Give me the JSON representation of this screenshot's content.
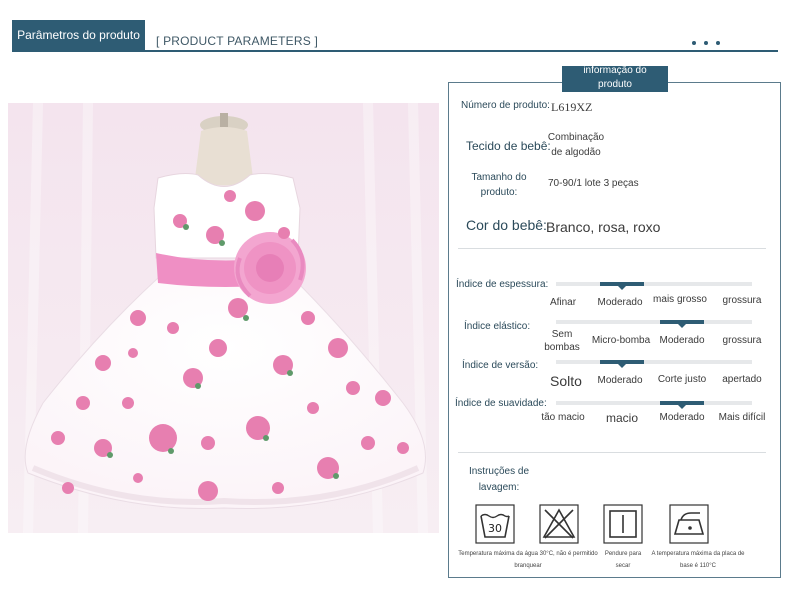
{
  "header": {
    "title": "Parâmetros do produto",
    "subtitle": "[ PRODUCT PARAMETERS ]"
  },
  "panel": {
    "badge": "informação do produto",
    "product_number": {
      "label": "Número de produto:",
      "value": "L619XZ"
    },
    "fabric": {
      "label": "Tecido de bebê:",
      "value": "Combinação de algodão"
    },
    "size": {
      "label": "Tamanho do produto:",
      "value": "70-90/1 lote 3 peças"
    },
    "color": {
      "label": "Cor do bebê:",
      "value": "Branco, rosa, roxo"
    },
    "indices": [
      {
        "label": "Índice de espessura:",
        "options": [
          "Afinar",
          "Moderado",
          "mais grosso",
          "grossura"
        ],
        "selected_index": 1
      },
      {
        "label": "Índice elástico:",
        "options": [
          "Sem bombas",
          "Micro-bomba",
          "Moderado",
          "grossura"
        ],
        "selected_index": 2
      },
      {
        "label": "Índice de versão:",
        "options": [
          "Solto",
          "Moderado",
          "Corte justo",
          "apertado"
        ],
        "selected_index": 1
      },
      {
        "label": "Índice de suavidade:",
        "options": [
          "tão macio",
          "macio",
          "Moderado",
          "Mais difícil"
        ],
        "selected_index": 2
      }
    ],
    "washing": {
      "title": "Instruções de lavagem:",
      "icons": [
        {
          "icon": "wash-30-icon",
          "number": "30",
          "caption": "Temperatura máxima da água 30°C, não é permitido branquear"
        },
        {
          "icon": "no-bleach-icon",
          "caption": ""
        },
        {
          "icon": "hang-dry-icon",
          "caption": "Pendure para secar"
        },
        {
          "icon": "iron-low-icon",
          "caption": "A temperatura máxima da placa de base é 110°C"
        }
      ]
    }
  },
  "colors": {
    "accent": "#2e5c74",
    "rose": "#e78fbf",
    "sash": "#ef8fc4"
  }
}
